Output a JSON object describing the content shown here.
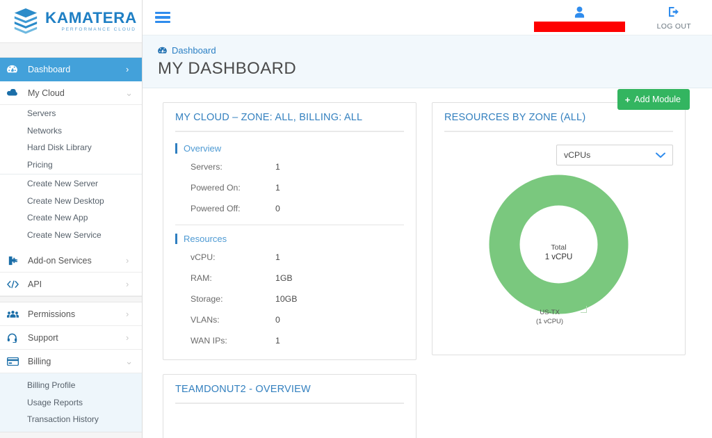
{
  "brand": {
    "name": "KAMATERA",
    "tagline": "PERFORMANCE CLOUD",
    "logo_icon": "kamatera-stacked-layers-logo",
    "color": "#1f7fc4"
  },
  "topbar": {
    "menu_toggle_icon": "hamburger-menu-icon",
    "user_icon": "user-avatar-icon",
    "user_name": "",
    "logout_icon": "logout-icon",
    "logout_label": "LOG OUT"
  },
  "page_head": {
    "breadcrumb_icon": "dashboard-gauge-icon",
    "breadcrumb": "Dashboard",
    "title": "MY DASHBOARD",
    "add_module_label": "Add Module",
    "add_module_plus": "+",
    "add_module_color": "#33b560"
  },
  "sidebar": {
    "active_color": "#43a1da",
    "items": [
      {
        "label": "Dashboard",
        "icon": "dashboard-gauge-icon",
        "chevron": "›",
        "active": true
      },
      {
        "label": "My Cloud",
        "icon": "cloud-icon",
        "chevron": "⌄",
        "active": false
      },
      {
        "label": "Add-on Services",
        "icon": "addon-plug-icon",
        "chevron": "›",
        "active": false
      },
      {
        "label": "API",
        "icon": "code-brackets-icon",
        "chevron": "›",
        "active": false
      },
      {
        "label": "Permissions",
        "icon": "users-group-icon",
        "chevron": "›",
        "active": false
      },
      {
        "label": "Support",
        "icon": "headset-icon",
        "chevron": "›",
        "active": false
      },
      {
        "label": "Billing",
        "icon": "credit-card-icon",
        "chevron": "⌄",
        "active": false
      }
    ],
    "my_cloud_sub_primary": [
      "Servers",
      "Networks",
      "Hard Disk Library",
      "Pricing"
    ],
    "my_cloud_sub_secondary": [
      "Create New Server",
      "Create New Desktop",
      "Create New App",
      "Create New Service"
    ],
    "billing_sub": [
      "Billing Profile",
      "Usage Reports",
      "Transaction History"
    ]
  },
  "my_cloud_card": {
    "title": "MY CLOUD – ZONE: ALL, BILLING: ALL",
    "overview_heading": "Overview",
    "overview": [
      {
        "label": "Servers:",
        "value": "1"
      },
      {
        "label": "Powered On:",
        "value": "1"
      },
      {
        "label": "Powered Off:",
        "value": "0"
      }
    ],
    "resources_heading": "Resources",
    "resources": [
      {
        "label": "vCPU:",
        "value": "1"
      },
      {
        "label": "RAM:",
        "value": "1GB"
      },
      {
        "label": "Storage:",
        "value": "10GB"
      },
      {
        "label": "VLANs:",
        "value": "0"
      },
      {
        "label": "WAN IPs:",
        "value": "1"
      }
    ]
  },
  "teamdonut_card": {
    "title": "TEAMDONUT2 - OVERVIEW"
  },
  "resources_by_zone_card": {
    "title": "RESOURCES BY ZONE (ALL)",
    "metric_selected": "vCPUs",
    "metric_options": [
      "vCPUs"
    ],
    "dropdown_icon": "chevron-down-icon",
    "center_line1": "Total",
    "center_line2": "1 vCPU"
  },
  "chart_data": {
    "type": "pie",
    "title": "RESOURCES BY ZONE (ALL)",
    "subtitle": "vCPUs",
    "categories": [
      "US-TX"
    ],
    "values": [
      1
    ],
    "labels": [
      "US-TX\n(1 vCPU)"
    ],
    "label_lines": [
      [
        "US-TX",
        "(1 vCPU)"
      ]
    ],
    "colors": [
      "#7ac87e"
    ],
    "total": 1,
    "unit": "vCPU",
    "center_text": [
      "Total",
      "1 vCPU"
    ],
    "donut": true,
    "inner_radius_ratio": 0.56,
    "legend": "none",
    "grid": false
  }
}
